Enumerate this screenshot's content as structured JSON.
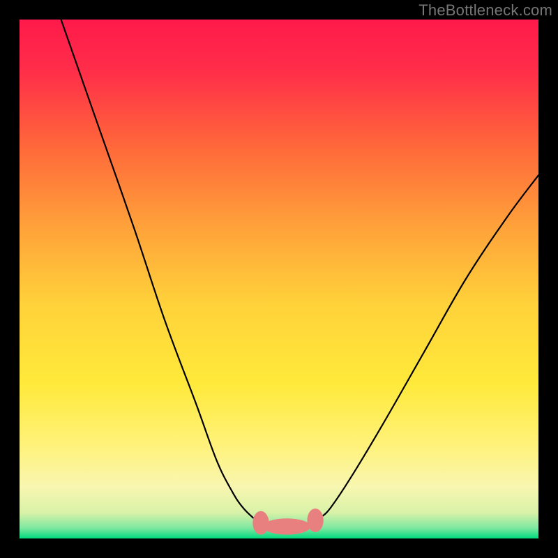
{
  "watermark": "TheBottleneck.com",
  "colors": {
    "gradient_top": "#ff1a4b",
    "gradient_mid_upper": "#ff6a3a",
    "gradient_mid": "#ffd93a",
    "gradient_mid_lower": "#fff27a",
    "gradient_low": "#f6f8c8",
    "gradient_bottom": "#00d97e",
    "frame": "#000000",
    "curve": "#000000",
    "blobs": "#e88080"
  },
  "chart_data": {
    "type": "line",
    "title": "",
    "xlabel": "",
    "ylabel": "",
    "xlim": [
      0,
      100
    ],
    "ylim": [
      0,
      100
    ],
    "grid": false,
    "legend": false,
    "annotations": [
      {
        "text": "TheBottleneck.com",
        "position": "top-right"
      }
    ],
    "series": [
      {
        "name": "left-curve",
        "x": [
          8,
          15,
          22,
          28,
          34,
          38,
          41,
          43,
          45,
          46.5,
          47.5
        ],
        "y": [
          100,
          80,
          60,
          42,
          26,
          15,
          9,
          6,
          4,
          3,
          2.5
        ]
      },
      {
        "name": "right-curve",
        "x": [
          56,
          58,
          60,
          64,
          70,
          78,
          86,
          94,
          100
        ],
        "y": [
          2.5,
          4,
          6,
          12,
          22,
          36,
          50,
          62,
          70
        ]
      },
      {
        "name": "bottom-flat",
        "x": [
          47.5,
          50,
          53,
          56
        ],
        "y": [
          2.5,
          2.3,
          2.3,
          2.5
        ]
      }
    ],
    "markers": [
      {
        "name": "blob-left",
        "x": 46.5,
        "y": 3,
        "rx": 1.5,
        "ry": 2.2
      },
      {
        "name": "blob-center",
        "x": 51.5,
        "y": 2.3,
        "rx": 4.5,
        "ry": 1.5
      },
      {
        "name": "blob-right",
        "x": 57,
        "y": 3.5,
        "rx": 1.5,
        "ry": 2.2
      }
    ]
  }
}
